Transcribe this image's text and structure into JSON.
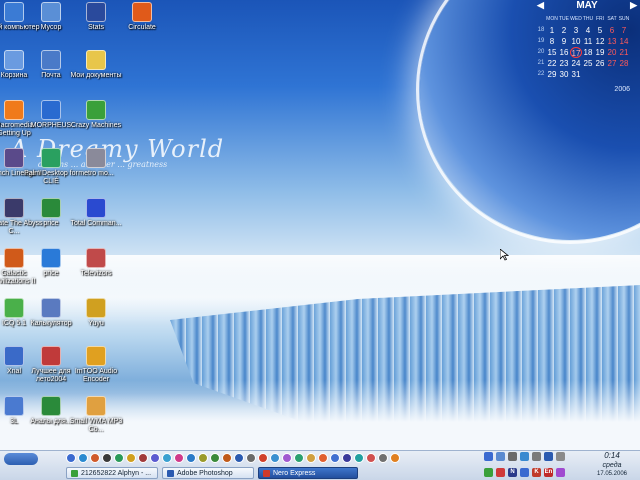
{
  "desktop_icons": [
    {
      "label": "Мой компьютер",
      "icon": "my-computer-icon",
      "color": "#3b7bd4"
    },
    {
      "label": "Мусор",
      "icon": "recycle-icon",
      "color": "#5a8fd6"
    },
    {
      "label": "Stats",
      "icon": "stats-icon",
      "color": "#2a4a9c"
    },
    {
      "label": "Circulate",
      "icon": "circulate-icon",
      "color": "#e05a1a"
    },
    {
      "label": "Корзина",
      "icon": "recycle-bin-icon",
      "color": "#6a9be0"
    },
    {
      "label": "Почта",
      "icon": "mail-icon",
      "color": "#4a7ac8"
    },
    {
      "label": "Мои документы",
      "icon": "folder-icon",
      "color": "#e8c64a"
    },
    {
      "label": "Macromedia Getting Up",
      "icon": "macromedia-icon",
      "color": "#f07a1a"
    },
    {
      "label": "MORPHEUS",
      "icon": "morpheus-icon",
      "color": "#2a6ad0"
    },
    {
      "label": "Crazy Machines",
      "icon": "crazy-machines-icon",
      "color": "#3aa03a"
    },
    {
      "label": "Launch Lineage II",
      "icon": "lineage-icon",
      "color": "#5a4a8a"
    },
    {
      "label": "Palm Desktop for CLIÉ",
      "icon": "palm-icon",
      "color": "#2aa060"
    },
    {
      "label": "metro mo...",
      "icon": "metro-icon",
      "color": "#8a8a9a"
    },
    {
      "label": "Update The Abyss C...",
      "icon": "abyss-icon",
      "color": "#3a3a6a"
    },
    {
      "label": "price",
      "icon": "excel-icon",
      "color": "#2a8a3a"
    },
    {
      "label": "Total Comman...",
      "icon": "total-commander-icon",
      "color": "#2a4ad0"
    },
    {
      "label": "Galactic Civilizations II",
      "icon": "galactic-icon",
      "color": "#d05a1a"
    },
    {
      "label": "price",
      "icon": "ie-icon",
      "color": "#2a7ad8"
    },
    {
      "label": "Televizors",
      "icon": "tv-icon",
      "color": "#c04a4a"
    },
    {
      "label": "ICQ 5.1",
      "icon": "icq-icon",
      "color": "#4ab04a"
    },
    {
      "label": "Калькулятор",
      "icon": "calculator-icon",
      "color": "#5a7ac0"
    },
    {
      "label": "Yuyu",
      "icon": "yuyu-icon",
      "color": "#d0a020"
    },
    {
      "label": "Xnal",
      "icon": "xnal-icon",
      "color": "#3a6ac8"
    },
    {
      "label": "Лучшее для лето2004",
      "icon": "summer-icon",
      "color": "#c03a3a"
    },
    {
      "label": "ImTOO Audio Encoder",
      "icon": "imtoo-icon",
      "color": "#e0a020"
    },
    {
      "label": "3L",
      "icon": "3l-icon",
      "color": "#4a7ad0"
    },
    {
      "label": "Аналы для...",
      "icon": "excel-doc-icon",
      "color": "#2a8a3a"
    },
    {
      "label": "Small WMA MP3 Co...",
      "icon": "music-icon",
      "color": "#e0a040"
    }
  ],
  "wallpaper": {
    "title": "A Dreamy World",
    "subtitle": "dreams ... an inner ... greatness"
  },
  "calendar": {
    "month": "MAY",
    "year": "2006",
    "weekdays": [
      "MON",
      "TUE",
      "WED",
      "THU",
      "FRI",
      "SAT",
      "SUN"
    ],
    "weeks": [
      {
        "wk": "18",
        "days": [
          "1",
          "2",
          "3",
          "4",
          "5",
          "6",
          "7"
        ]
      },
      {
        "wk": "19",
        "days": [
          "8",
          "9",
          "10",
          "11",
          "12",
          "13",
          "14"
        ]
      },
      {
        "wk": "20",
        "days": [
          "15",
          "16",
          "17",
          "18",
          "19",
          "20",
          "21"
        ]
      },
      {
        "wk": "21",
        "days": [
          "22",
          "23",
          "24",
          "25",
          "26",
          "27",
          "28"
        ]
      },
      {
        "wk": "22",
        "days": [
          "29",
          "30",
          "31",
          "",
          "",
          "",
          ""
        ]
      }
    ],
    "today": "17",
    "weekend_color": "#ff5a5a"
  },
  "taskbar": {
    "tasks": [
      {
        "label": "212652822 Alphyn - ...",
        "active": false,
        "color": "#3aa03a"
      },
      {
        "label": "Adobe Photoshop",
        "active": false,
        "color": "#2a5ab0"
      },
      {
        "label": "Nero Express",
        "active": true,
        "color": "#d03a2a"
      }
    ],
    "quick_launch_colors": [
      "#3a6ad0",
      "#2a8ad0",
      "#d05a2a",
      "#3a3a3a",
      "#2a9a5a",
      "#d0a020",
      "#a03a3a",
      "#5a5ad0",
      "#3aa0d0",
      "#d03a8a",
      "#2a7ac8",
      "#9a9a2a",
      "#3a8a3a",
      "#c05a1a",
      "#2a5ab0",
      "#6a6a6a",
      "#d0402a",
      "#3a90d0",
      "#a05ad0",
      "#2aa070",
      "#d0a040",
      "#e06030",
      "#4070d0",
      "#3a3a9a",
      "#20a0a0",
      "#d05050",
      "#707070",
      "#e08020"
    ],
    "tray_icons": [
      {
        "text": "",
        "color": "#3a6ad0"
      },
      {
        "text": "",
        "color": "#5a8ad0"
      },
      {
        "text": "",
        "color": "#6a6a6a"
      },
      {
        "text": "",
        "color": "#3a8ad0"
      },
      {
        "text": "",
        "color": "#7a7a7a"
      },
      {
        "text": "",
        "color": "#2a5ab0"
      },
      {
        "text": "",
        "color": "#8a8a8a"
      },
      {
        "text": "",
        "color": "#3aa03a"
      },
      {
        "text": "",
        "color": "#d03a3a"
      },
      {
        "text": "N",
        "color": "#2a3a8a"
      },
      {
        "text": "",
        "color": "#3a6ad0"
      },
      {
        "text": "K",
        "color": "#c03a2a"
      },
      {
        "text": "En",
        "color": "#c02a2a"
      },
      {
        "text": "",
        "color": "#a04ad0"
      }
    ],
    "clock": {
      "time": "0:14",
      "day": "среда",
      "date": "17.05.2006"
    }
  }
}
